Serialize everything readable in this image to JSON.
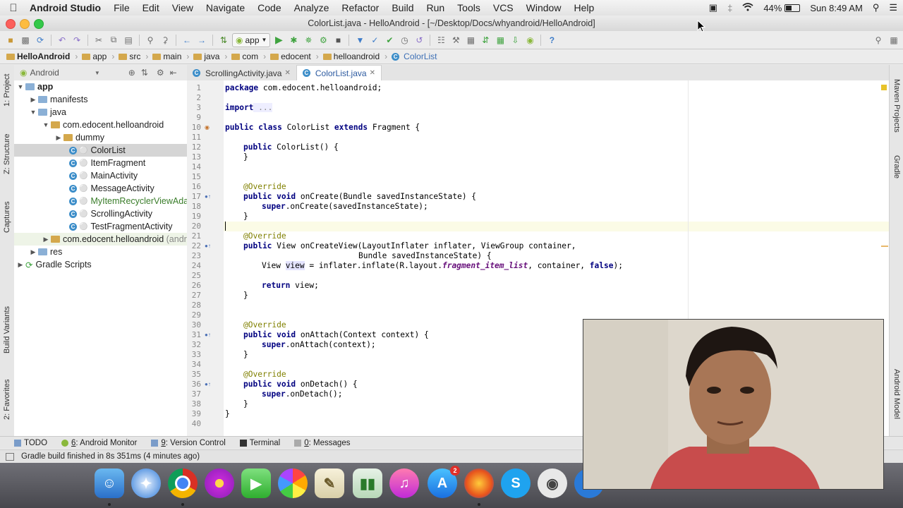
{
  "menubar": {
    "apple_icon": "apple-icon",
    "app_name": "Android Studio",
    "items": [
      "File",
      "Edit",
      "View",
      "Navigate",
      "Code",
      "Analyze",
      "Refactor",
      "Build",
      "Run",
      "Tools",
      "VCS",
      "Window",
      "Help"
    ],
    "battery": "44%",
    "clock": "Sun 8:49 AM"
  },
  "window": {
    "title": "ColorList.java - HelloAndroid - [~/Desktop/Docs/whyandroid/HelloAndroid]"
  },
  "toolbar": {
    "run_config": "app"
  },
  "breadcrumb": [
    "HelloAndroid",
    "app",
    "src",
    "main",
    "java",
    "com",
    "edocent",
    "helloandroid",
    "ColorList"
  ],
  "project_pane": {
    "view_selector": "Android",
    "tree": [
      {
        "label": "app",
        "bold": true
      },
      {
        "label": "manifests"
      },
      {
        "label": "java"
      },
      {
        "label": "com.edocent.helloandroid"
      },
      {
        "label": "dummy"
      },
      {
        "label": "ColorList"
      },
      {
        "label": "ItemFragment"
      },
      {
        "label": "MainActivity"
      },
      {
        "label": "MessageActivity"
      },
      {
        "label": "MyItemRecyclerViewAdap"
      },
      {
        "label": "ScrollingActivity"
      },
      {
        "label": "TestFragmentActivity"
      },
      {
        "label": "com.edocent.helloandroid",
        "suffix": "(andr"
      },
      {
        "label": "res"
      },
      {
        "label": "Gradle Scripts"
      }
    ]
  },
  "left_tool_tabs": [
    "1: Project",
    "Z: Structure",
    "Captures",
    "Build Variants",
    "2: Favorites"
  ],
  "right_tool_tabs": [
    "Maven Projects",
    "Gradle",
    "Android Model"
  ],
  "editor": {
    "tabs": [
      "ScrollingActivity.java",
      "ColorList.java"
    ],
    "active_tab": "ColorList.java",
    "line_numbers": [
      "1",
      "2",
      "3",
      "9",
      "10",
      "11",
      "12",
      "13",
      "14",
      "15",
      "16",
      "17",
      "18",
      "19",
      "20",
      "21",
      "22",
      "23",
      "24",
      "25",
      "26",
      "27",
      "28",
      "29",
      "30",
      "31",
      "32",
      "33",
      "34",
      "35",
      "36",
      "37",
      "38",
      "39",
      "40"
    ],
    "code": {
      "l1_kw": "package",
      "l1_rest": " com.edocent.helloandroid;",
      "l3_kw": "import",
      "l3_rest": " ...",
      "l10_kw": "public class",
      "l10_name": " ColorList ",
      "l10_kw2": "extends",
      "l10_rest": " Fragment {",
      "l12_kw": "public",
      "l12_rest": " ColorList() {",
      "l13": "}",
      "override": "@Override",
      "l17_kw": "public void",
      "l17_rest": " onCreate(Bundle savedInstanceState) {",
      "l18_kw": "super",
      "l18_rest": ".onCreate(savedInstanceState);",
      "l19": "}",
      "l22_kw": "public",
      "l22_rest": " View onCreateView(LayoutInflater inflater, ViewGroup container,",
      "l23": "Bundle savedInstanceState) {",
      "l24_a": "View ",
      "l24_var": "view",
      "l24_b": " = inflater.inflate(R.layout.",
      "l24_it": "fragment_item_list",
      "l24_c": ", container, ",
      "l24_kw": "false",
      "l24_d": ");",
      "l26_kw": "return",
      "l26_rest": " view;",
      "l27": "}",
      "l31_kw": "public void",
      "l31_rest": " onAttach(Context context) {",
      "l32_kw": "super",
      "l32_rest": ".onAttach(context);",
      "l33": "}",
      "l36_kw": "public void",
      "l36_rest": " onDetach() {",
      "l37_kw": "super",
      "l37_rest": ".onDetach();",
      "l38": "}",
      "l39": "}"
    }
  },
  "bottom_tabs": [
    {
      "label": "TODO"
    },
    {
      "key": "6",
      "label": ": Android Monitor"
    },
    {
      "key": "9",
      "label": ": Version Control"
    },
    {
      "label": "Terminal"
    },
    {
      "key": "0",
      "label": ": Messages"
    }
  ],
  "status": {
    "message": "Gradle build finished in 8s 351ms (4 minutes ago)"
  },
  "dock": {
    "app_store_badge": "2"
  },
  "colors": {
    "keyword": "#000080",
    "annotation": "#808000",
    "field_italic": "#660e7a",
    "class_icon": "#3d8ec9"
  }
}
